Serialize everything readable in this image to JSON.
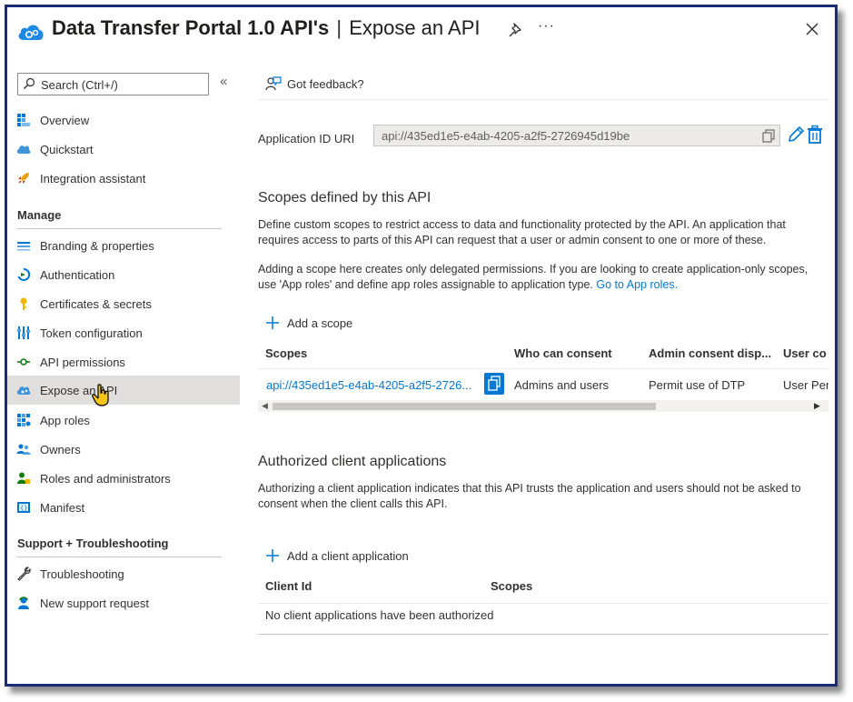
{
  "header": {
    "title_bold": "Data Transfer Portal 1.0 API's",
    "separator": "|",
    "title_sub": "Expose an API",
    "more_label": "···"
  },
  "sidebar": {
    "search_placeholder": "Search (Ctrl+/)",
    "collapse_label": "«",
    "items_top": [
      {
        "label": "Overview",
        "icon": "overview-icon"
      },
      {
        "label": "Quickstart",
        "icon": "quickstart-icon"
      },
      {
        "label": "Integration assistant",
        "icon": "rocket-icon"
      }
    ],
    "manage_header": "Manage",
    "manage_items": [
      {
        "label": "Branding & properties",
        "icon": "branding-icon"
      },
      {
        "label": "Authentication",
        "icon": "authentication-icon"
      },
      {
        "label": "Certificates & secrets",
        "icon": "key-icon"
      },
      {
        "label": "Token configuration",
        "icon": "token-icon"
      },
      {
        "label": "API permissions",
        "icon": "api-permissions-icon"
      },
      {
        "label": "Expose an API",
        "icon": "expose-api-icon",
        "active": true
      },
      {
        "label": "App roles",
        "icon": "app-roles-icon"
      },
      {
        "label": "Owners",
        "icon": "owners-icon"
      },
      {
        "label": "Roles and administrators",
        "icon": "roles-icon"
      },
      {
        "label": "Manifest",
        "icon": "manifest-icon"
      }
    ],
    "support_header": "Support + Troubleshooting",
    "support_items": [
      {
        "label": "Troubleshooting",
        "icon": "wrench-icon"
      },
      {
        "label": "New support request",
        "icon": "support-icon"
      }
    ]
  },
  "main": {
    "feedback_label": "Got feedback?",
    "app_id_label": "Application ID URI",
    "app_id_value": "api://435ed1e5-e4ab-4205-a2f5-2726945d19be",
    "scopes_heading": "Scopes defined by this API",
    "scopes_para1": "Define custom scopes to restrict access to data and functionality protected by the API. An application that requires access to parts of this API can request that a user or admin consent to one or more of these.",
    "scopes_para2": "Adding a scope here creates only delegated permissions. If you are looking to create application-only scopes, use 'App roles' and define app roles assignable to application type.",
    "scopes_para2_link": "Go to App roles.",
    "add_scope_label": "Add a scope",
    "scopes_table": {
      "columns": [
        "Scopes",
        "Who can consent",
        "Admin consent disp...",
        "User co"
      ],
      "rows": [
        [
          "api://435ed1e5-e4ab-4205-a2f5-2726...",
          "Admins and users",
          "Permit use of DTP",
          "User Per"
        ]
      ]
    },
    "clients_heading": "Authorized client applications",
    "clients_para": "Authorizing a client application indicates that this API trusts the application and users should not be asked to consent when the client calls this API.",
    "add_client_label": "Add a client application",
    "clients_table": {
      "columns": [
        "Client Id",
        "Scopes"
      ],
      "empty_message": "No client applications have been authorized"
    }
  },
  "colors": {
    "accent": "#0078d4",
    "frame_border": "#1a2b7a",
    "active_nav": "#e1dfdd"
  }
}
